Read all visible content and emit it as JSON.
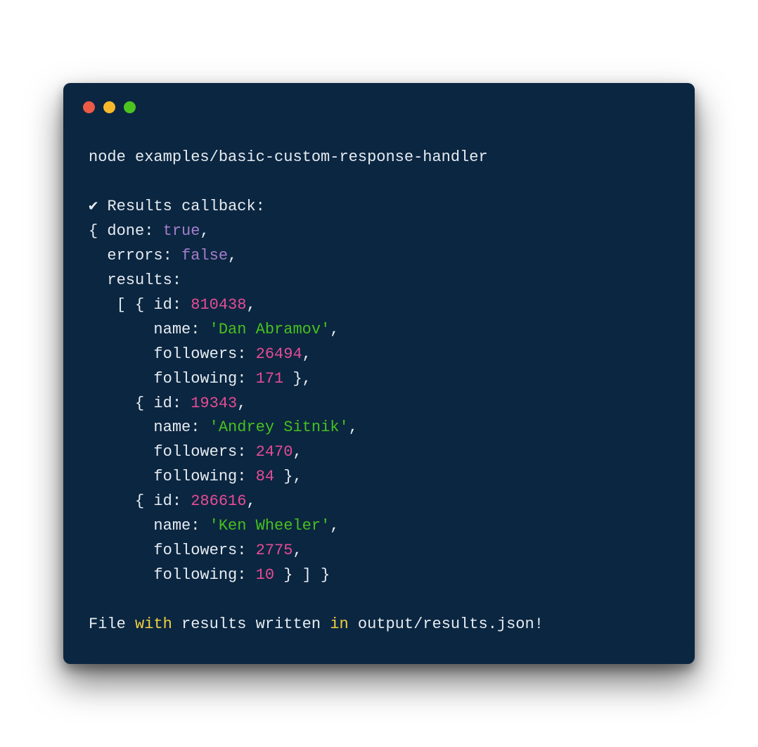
{
  "window": {
    "traffic_lights": {
      "red": "#ed5a46",
      "yellow": "#f7b92b",
      "green": "#4dc31f"
    }
  },
  "term": {
    "cmd": "node examples/basic-custom-response-handler",
    "blank1": "",
    "check": "✔",
    "cb_label": " Results callback:",
    "l_open": "{ done: ",
    "v_done": "true",
    "comma1": ",",
    "l_errors": "  errors: ",
    "v_errors": "false",
    "comma2": ",",
    "l_results": "  results:",
    "r0_open": "   [ { id: ",
    "r0_id": "810438",
    "r0_c1": ",",
    "r0_namek": "       name: ",
    "r0_name": "'Dan Abramov'",
    "r0_c2": ",",
    "r0_folk": "       followers: ",
    "r0_fol": "26494",
    "r0_c3": ",",
    "r0_fgk": "       following: ",
    "r0_fg": "171",
    "r0_close": " },",
    "r1_open": "     { id: ",
    "r1_id": "19343",
    "r1_c1": ",",
    "r1_namek": "       name: ",
    "r1_name": "'Andrey Sitnik'",
    "r1_c2": ",",
    "r1_folk": "       followers: ",
    "r1_fol": "2470",
    "r1_c3": ",",
    "r1_fgk": "       following: ",
    "r1_fg": "84",
    "r1_close": " },",
    "r2_open": "     { id: ",
    "r2_id": "286616",
    "r2_c1": ",",
    "r2_namek": "       name: ",
    "r2_name": "'Ken Wheeler'",
    "r2_c2": ",",
    "r2_folk": "       followers: ",
    "r2_fol": "2775",
    "r2_c3": ",",
    "r2_fgk": "       following: ",
    "r2_fg": "10",
    "r2_close": " } ] }",
    "blank2": "",
    "outfile_pre": "File ",
    "outfile_with": "with",
    "outfile_mid": " results written ",
    "outfile_in": "in",
    "outfile_post": " output/results.json!"
  }
}
